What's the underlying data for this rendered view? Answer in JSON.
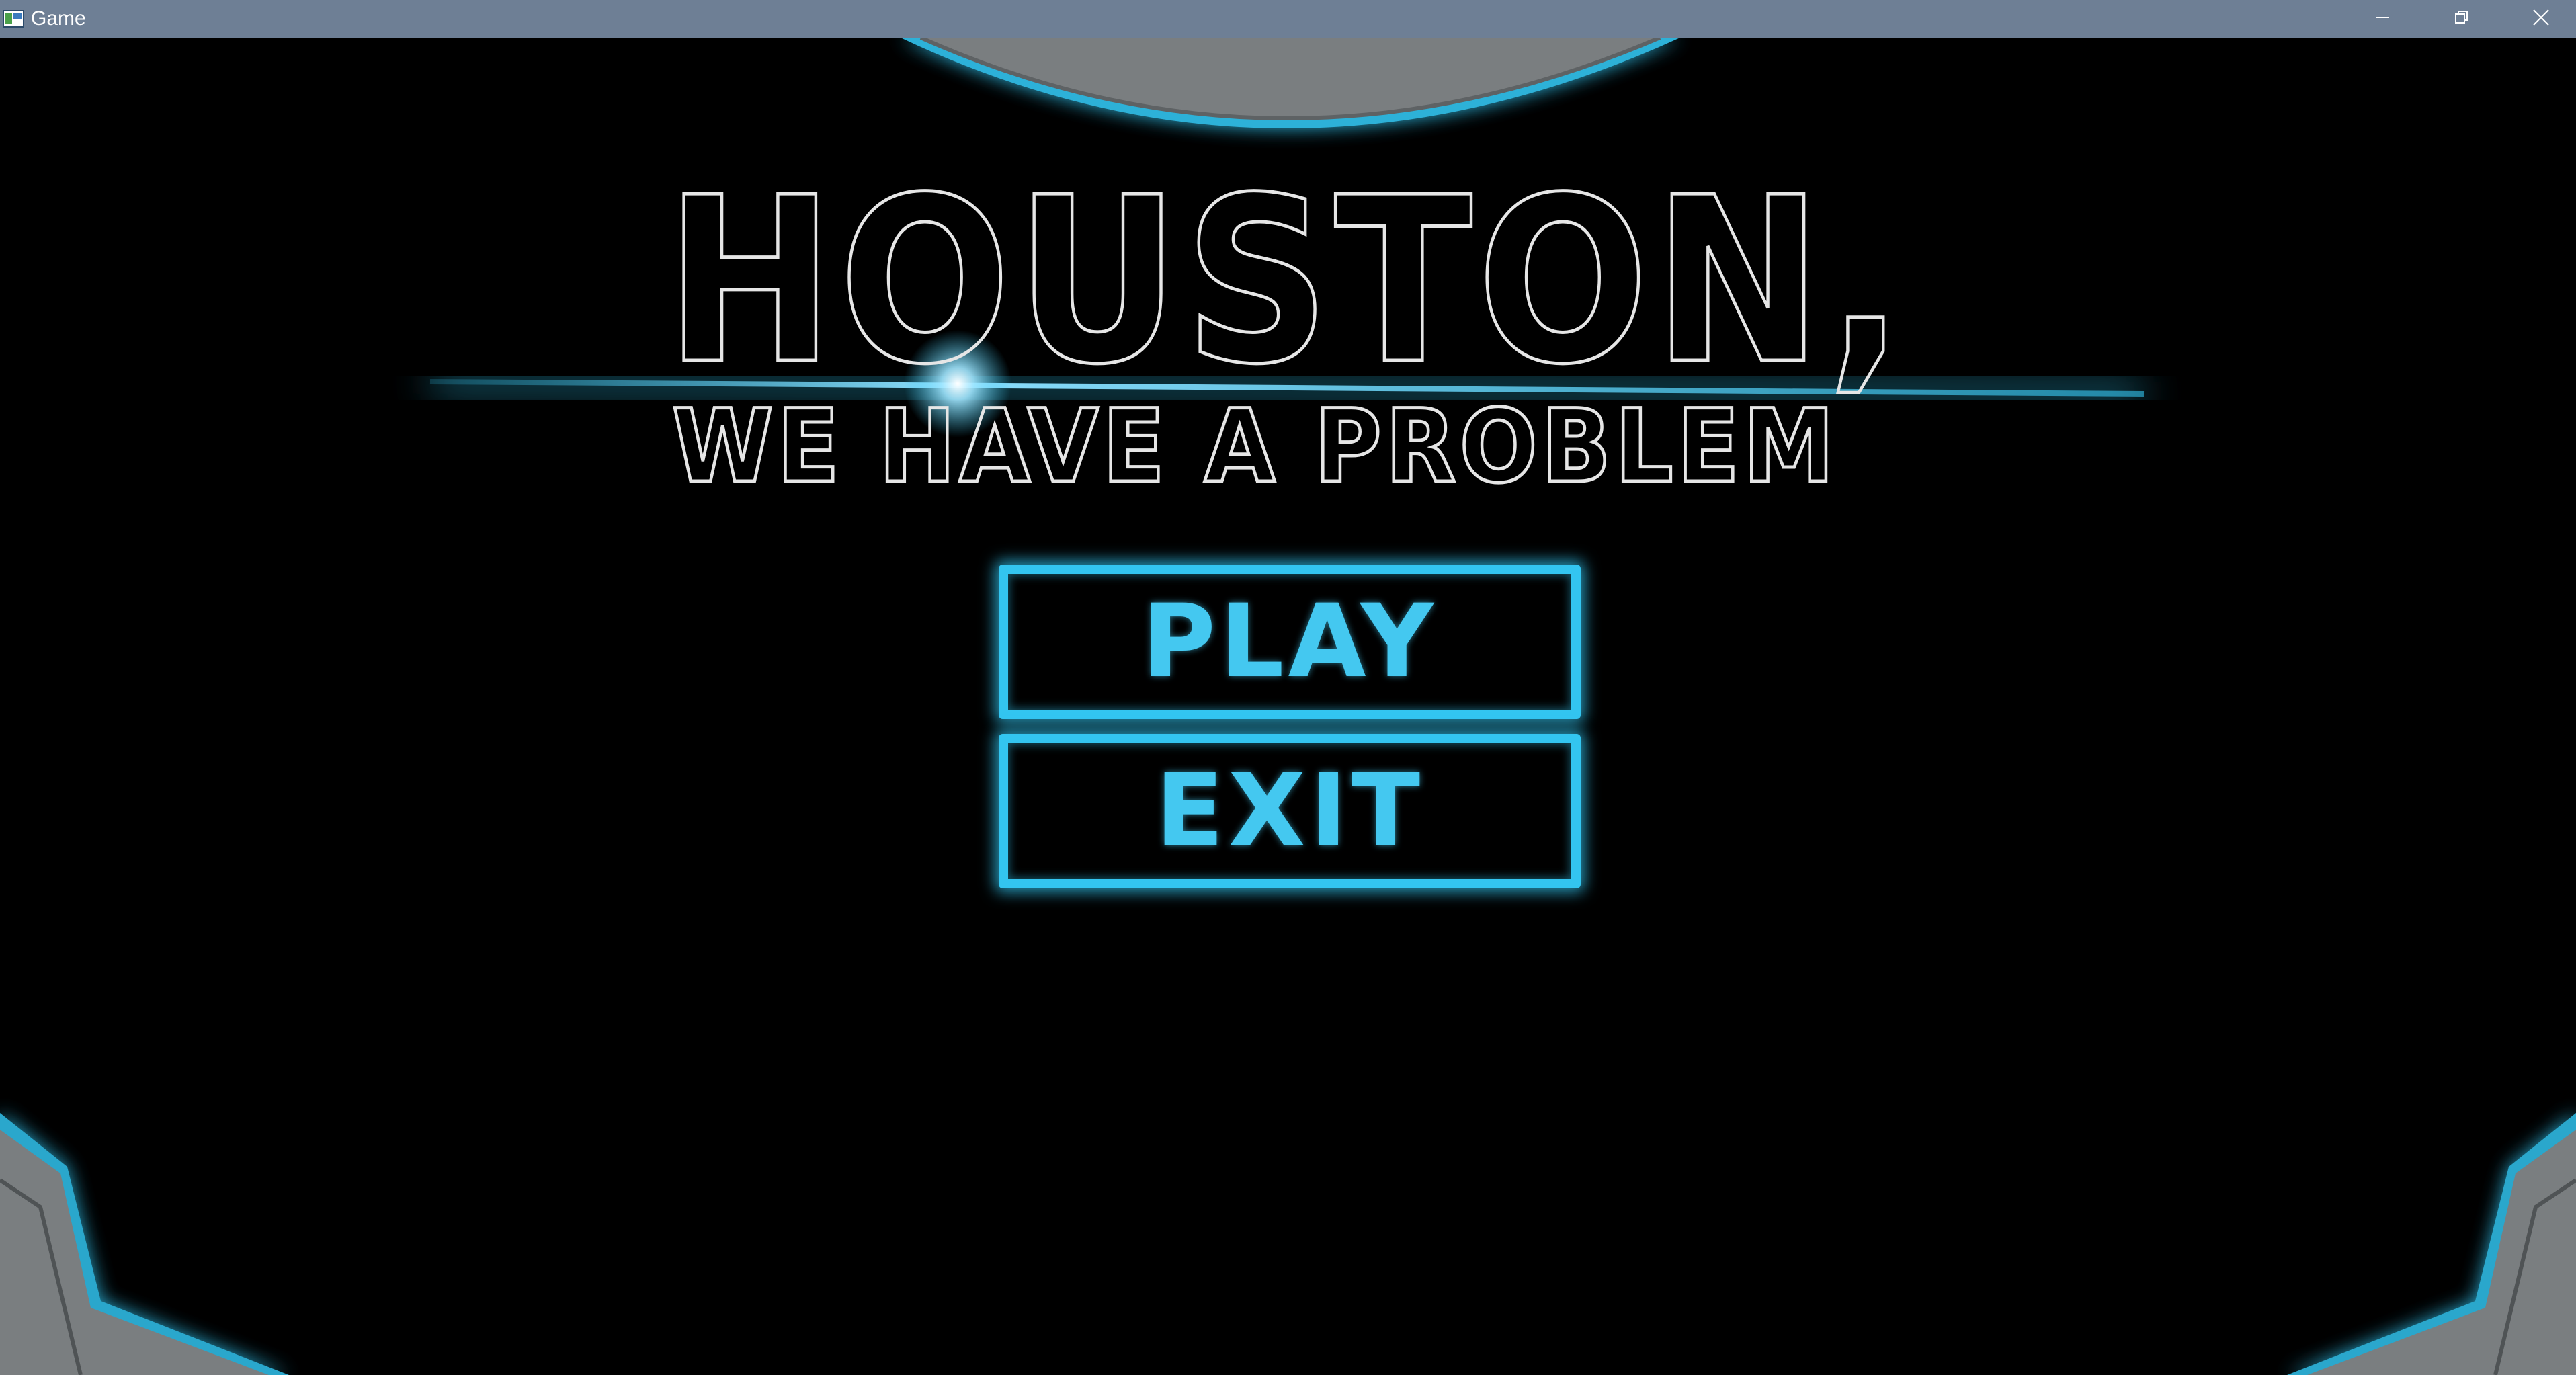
{
  "window": {
    "title": "Game",
    "controls": [
      "minimize",
      "maximize",
      "close"
    ]
  },
  "game": {
    "title_line1": "HOUSTON,",
    "title_line2": "WE HAVE A PROBLEM"
  },
  "menu": {
    "play_label": "PLAY",
    "exit_label": "EXIT"
  },
  "colors": {
    "titlebar": "#6e7f95",
    "neon_accent": "#33c5f0",
    "title_outline": "#e6e6e6",
    "panel_gray": "#7a7e80",
    "background": "#000000"
  },
  "icons": {
    "app": "game-window-icon",
    "minimize": "minimize-icon",
    "maximize": "restore-icon",
    "close": "close-icon"
  }
}
